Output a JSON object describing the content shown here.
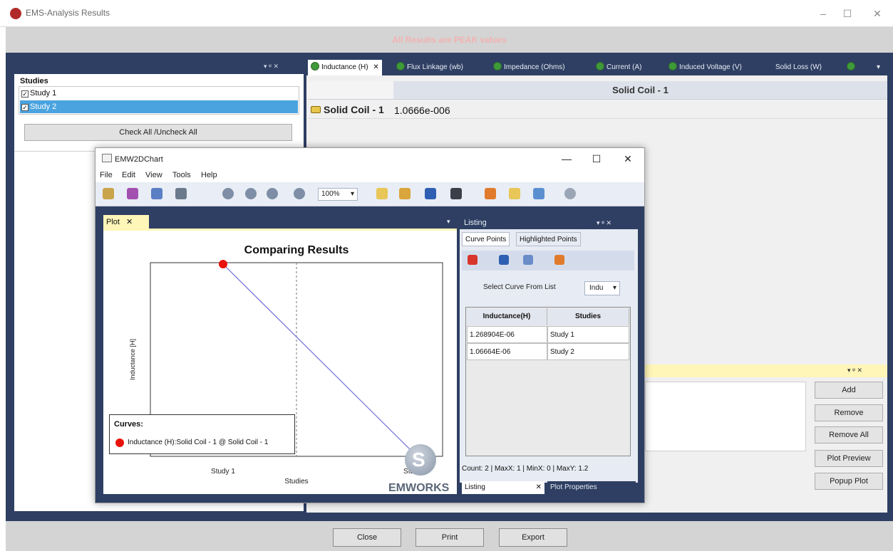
{
  "window": {
    "title": "EMS-Analysis Results",
    "minimize": "–",
    "maximize": "☐",
    "close": "✕"
  },
  "banner": {
    "text": "All Results are PEAK values"
  },
  "studies_panel": {
    "controls": "▾  ᵠ  ✕",
    "label": "Studies",
    "items": [
      {
        "label": "Study 1",
        "checked": "✓"
      },
      {
        "label": "Study 2",
        "checked": "✓"
      }
    ],
    "check_all_button": "Check All /Uncheck All"
  },
  "tabs": [
    {
      "label": "Inductance (H)",
      "close": "✕"
    },
    {
      "label": "Flux Linkage (wb)"
    },
    {
      "label": "Impedance (Ohms)"
    },
    {
      "label": "Current (A)"
    },
    {
      "label": "Induced Voltage (V)"
    },
    {
      "label": "Solid Loss (W)"
    }
  ],
  "tab_overflow": "▾",
  "results_grid": {
    "column_header": "Solid Coil - 1",
    "row_header": "Solid Coil - 1",
    "value": "1.0666e-006"
  },
  "side_panel": {
    "controls": "▾  ᵠ  ✕",
    "buttons": [
      "Add",
      "Remove",
      "Remove All",
      "Plot Preview",
      "Popup Plot"
    ]
  },
  "footer_buttons": [
    "Close",
    "Print",
    "Export"
  ],
  "chart_window": {
    "title": "EMW2DChart",
    "minimize": "—",
    "maximize": "☐",
    "close": "✕",
    "menu": [
      "File",
      "Edit",
      "View",
      "Tools",
      "Help"
    ],
    "zoom_value": "100%",
    "zoom_arrow": "▾"
  },
  "plot_tab": {
    "label": "Plot",
    "close": "✕",
    "menu_arrow": "▾"
  },
  "chart_data": {
    "type": "line",
    "title": "Comparing Results",
    "xlabel": "Studies",
    "ylabel": "Inductance [H]",
    "categories": [
      "Study 1",
      "Study 2"
    ],
    "series": [
      {
        "name": "Inductance (H):Solid Coil - 1 @ Solid Coil - 1",
        "values": [
          1.268904e-06,
          1.06664e-06
        ],
        "color": "#e8120c",
        "line_color": "#6f6fdc"
      }
    ],
    "legend_title": "Curves:",
    "legend_position": "bottom-left",
    "grid": false
  },
  "emworks": {
    "text": "EMWORKS",
    "glyph": "S"
  },
  "listing": {
    "title": "Listing",
    "controls": "▾  ᵠ  ✕",
    "tabs": [
      "Curve Points",
      "Highlighted Points"
    ],
    "select_label": "Select Curve From List",
    "select_value": "Indu",
    "select_arrow": "▾",
    "table": {
      "headers": [
        "Inductance(H)",
        "Studies"
      ],
      "rows": [
        [
          "1.268904E-06",
          "Study 1"
        ],
        [
          "1.06664E-06",
          "Study 2"
        ]
      ]
    },
    "status": "Count: 2  |  MaxX: 1  |  MinX: 0  |  MaxY: 1.2",
    "bottom_tabs": [
      {
        "label": "Listing",
        "close": "✕"
      },
      {
        "label": "Plot Properties"
      }
    ]
  }
}
